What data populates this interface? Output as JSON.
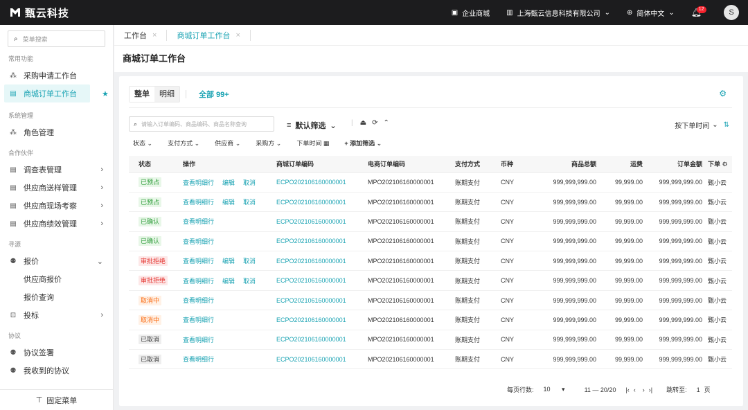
{
  "topbar": {
    "brand": "甄云科技",
    "mall": "企业商城",
    "company": "上海甄云信息科技有限公司",
    "language": "简体中文",
    "notification_count": "12",
    "avatar": "S"
  },
  "sidebar": {
    "search_placeholder": "菜单搜索",
    "sections": [
      {
        "title": "常用功能"
      },
      {
        "title": "系统管理"
      },
      {
        "title": "合作伙伴"
      },
      {
        "title": "寻源"
      },
      {
        "title": "协议"
      }
    ],
    "items": {
      "purchase_request": "采购申请工作台",
      "mall_order": "商城订单工作台",
      "role_mgmt": "角色管理",
      "survey": "调查表管理",
      "sample": "供应商送样管理",
      "onsite": "供应商现场考察",
      "performance": "供应商绩效管理",
      "quote": "报价",
      "supplier_quote": "供应商报价",
      "quote_query": "报价查询",
      "bid": "投标",
      "agreement_sign": "协议签署",
      "received_agreements": "我收到的协议"
    },
    "pin_menu": "固定菜单"
  },
  "tabs": [
    {
      "label": "工作台"
    },
    {
      "label": "商城订单工作台"
    }
  ],
  "page_title": "商城订单工作台",
  "card": {
    "seg_whole": "整单",
    "seg_detail": "明细",
    "all_count": "全部 99+",
    "query_placeholder": "请输入订单编码、商品编码、商品名称查询",
    "default_filter": "默认筛选",
    "sort_by": "按下单时间",
    "filters": [
      "状态",
      "支付方式",
      "供应商",
      "采购方",
      "下单时间"
    ],
    "add_filter": "添加筛选"
  },
  "table": {
    "headers": [
      "状态",
      "操作",
      "商城订单编码",
      "电商订单编码",
      "支付方式",
      "币种",
      "商品总额",
      "运费",
      "订单金额",
      "下单"
    ],
    "actions": {
      "view": "查看明细行",
      "edit": "编辑",
      "cancel": "取消"
    },
    "rows": [
      {
        "status": "已预占",
        "order": "ECPO202106160000001",
        "ec_order": "MPO202106160000001",
        "pay": "账期支付",
        "currency": "CNY",
        "total": "999,999,999.00",
        "freight": "99,999.00",
        "amount": "999,999,999.00",
        "by": "甄小云"
      },
      {
        "status": "已预占",
        "order": "ECPO202106160000001",
        "ec_order": "MPO202106160000001",
        "pay": "账期支付",
        "currency": "CNY",
        "total": "999,999,999.00",
        "freight": "99,999.00",
        "amount": "999,999,999.00",
        "by": "甄小云"
      },
      {
        "status": "已确认",
        "order": "ECPO202106160000001",
        "ec_order": "MPO202106160000001",
        "pay": "账期支付",
        "currency": "CNY",
        "total": "999,999,999.00",
        "freight": "99,999.00",
        "amount": "999,999,999.00",
        "by": "甄小云"
      },
      {
        "status": "已确认",
        "order": "ECPO202106160000001",
        "ec_order": "MPO202106160000001",
        "pay": "账期支付",
        "currency": "CNY",
        "total": "999,999,999.00",
        "freight": "99,999.00",
        "amount": "999,999,999.00",
        "by": "甄小云"
      },
      {
        "status": "审批拒绝",
        "order": "ECPO202106160000001",
        "ec_order": "MPO202106160000001",
        "pay": "账期支付",
        "currency": "CNY",
        "total": "999,999,999.00",
        "freight": "99,999.00",
        "amount": "999,999,999.00",
        "by": "甄小云"
      },
      {
        "status": "审批拒绝",
        "order": "ECPO202106160000001",
        "ec_order": "MPO202106160000001",
        "pay": "账期支付",
        "currency": "CNY",
        "total": "999,999,999.00",
        "freight": "99,999.00",
        "amount": "999,999,999.00",
        "by": "甄小云"
      },
      {
        "status": "取消中",
        "order": "ECPO202106160000001",
        "ec_order": "MPO202106160000001",
        "pay": "账期支付",
        "currency": "CNY",
        "total": "999,999,999.00",
        "freight": "99,999.00",
        "amount": "999,999,999.00",
        "by": "甄小云"
      },
      {
        "status": "取消中",
        "order": "ECPO202106160000001",
        "ec_order": "MPO202106160000001",
        "pay": "账期支付",
        "currency": "CNY",
        "total": "999,999,999.00",
        "freight": "99,999.00",
        "amount": "999,999,999.00",
        "by": "甄小云"
      },
      {
        "status": "已取消",
        "order": "ECPO202106160000001",
        "ec_order": "MPO202106160000001",
        "pay": "账期支付",
        "currency": "CNY",
        "total": "999,999,999.00",
        "freight": "99,999.00",
        "amount": "999,999,999.00",
        "by": "甄小云"
      },
      {
        "status": "已取消",
        "order": "ECPO202106160000001",
        "ec_order": "MPO202106160000001",
        "pay": "账期支付",
        "currency": "CNY",
        "total": "999,999,999.00",
        "freight": "99,999.00",
        "amount": "999,999,999.00",
        "by": "甄小云"
      }
    ]
  },
  "pager": {
    "rows_per_page_label": "每页行数:",
    "rows_per_page": "10",
    "range": "11 — 20/20",
    "jump_label": "跳转至:",
    "page_input": "1",
    "page_unit": "页"
  }
}
